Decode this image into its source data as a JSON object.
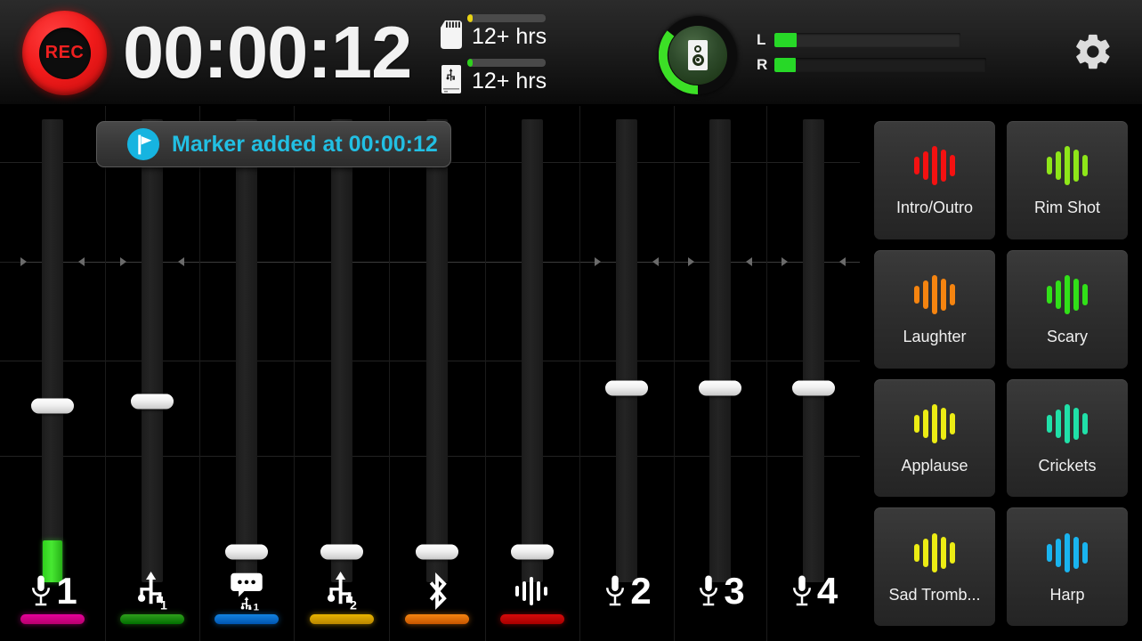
{
  "header": {
    "rec_label": "REC",
    "timer": "00:00:12",
    "storage": [
      {
        "icon": "sd-card-icon",
        "text": "12+ hrs",
        "indicator_color": "#e8d313",
        "fill_pct": 7
      },
      {
        "icon": "usb-drive-icon",
        "text": "12+ hrs",
        "indicator_color": "#2fd11d",
        "fill_pct": 7
      }
    ],
    "monitor": {
      "icon": "speaker-icon",
      "arc_color": "#3ce026",
      "level_pct": 35
    },
    "meters": [
      {
        "label": "L",
        "fill_pct": 12,
        "color": "#27d827"
      },
      {
        "label": "R",
        "fill_pct": 11,
        "color": "#27d827"
      }
    ],
    "settings_icon": "gear-icon"
  },
  "toast": {
    "icon": "marker-flag-icon",
    "text": "Marker added at 00:00:12",
    "accent": "#22bfe3"
  },
  "mixer": {
    "channels": [
      {
        "name": "mic-1",
        "icon": "microphone-icon",
        "number": "1",
        "sub": "",
        "color": "#e6009b",
        "fader_pct": 38,
        "meter_pct": 9,
        "has_meter": true
      },
      {
        "name": "usb-1",
        "icon": "usb-icon",
        "number": "",
        "sub": "1",
        "color": "#2f9e1c",
        "fader_pct": 39,
        "meter_pct": 0,
        "has_meter": false
      },
      {
        "name": "chat-usb-1",
        "icon": "chat-bubble-usb-icon",
        "number": "",
        "sub": "1",
        "color": "#1383e0",
        "fader_pct": 0,
        "meter_pct": 0,
        "has_meter": false
      },
      {
        "name": "usb-2",
        "icon": "usb-icon",
        "number": "",
        "sub": "2",
        "color": "#e8b400",
        "fader_pct": 0,
        "meter_pct": 0,
        "has_meter": false
      },
      {
        "name": "bluetooth",
        "icon": "bluetooth-icon",
        "number": "",
        "sub": "",
        "color": "#f58410",
        "fader_pct": 0,
        "meter_pct": 0,
        "has_meter": false
      },
      {
        "name": "sound-fx",
        "icon": "waveform-icon",
        "number": "",
        "sub": "",
        "color": "#d60a0a",
        "fader_pct": 0,
        "meter_pct": 0,
        "has_meter": false
      },
      {
        "name": "mic-2",
        "icon": "microphone-icon",
        "number": "2",
        "sub": "",
        "color": "",
        "fader_pct": 42,
        "meter_pct": 0,
        "has_meter": false
      },
      {
        "name": "mic-3",
        "icon": "microphone-icon",
        "number": "3",
        "sub": "",
        "color": "",
        "fader_pct": 42,
        "meter_pct": 0,
        "has_meter": false
      },
      {
        "name": "mic-4",
        "icon": "microphone-icon",
        "number": "4",
        "sub": "",
        "color": "",
        "fader_pct": 42,
        "meter_pct": 0,
        "has_meter": false
      }
    ]
  },
  "pads": [
    {
      "label": "Intro/Outro",
      "color": "#f41111"
    },
    {
      "label": "Rim Shot",
      "color": "#8ee619"
    },
    {
      "label": "Laughter",
      "color": "#f58410"
    },
    {
      "label": "Scary",
      "color": "#31e018"
    },
    {
      "label": "Applause",
      "color": "#ecec14"
    },
    {
      "label": "Crickets",
      "color": "#20e0a8"
    },
    {
      "label": "Sad Tromb...",
      "color": "#ecec14"
    },
    {
      "label": "Harp",
      "color": "#19b4ef"
    }
  ]
}
